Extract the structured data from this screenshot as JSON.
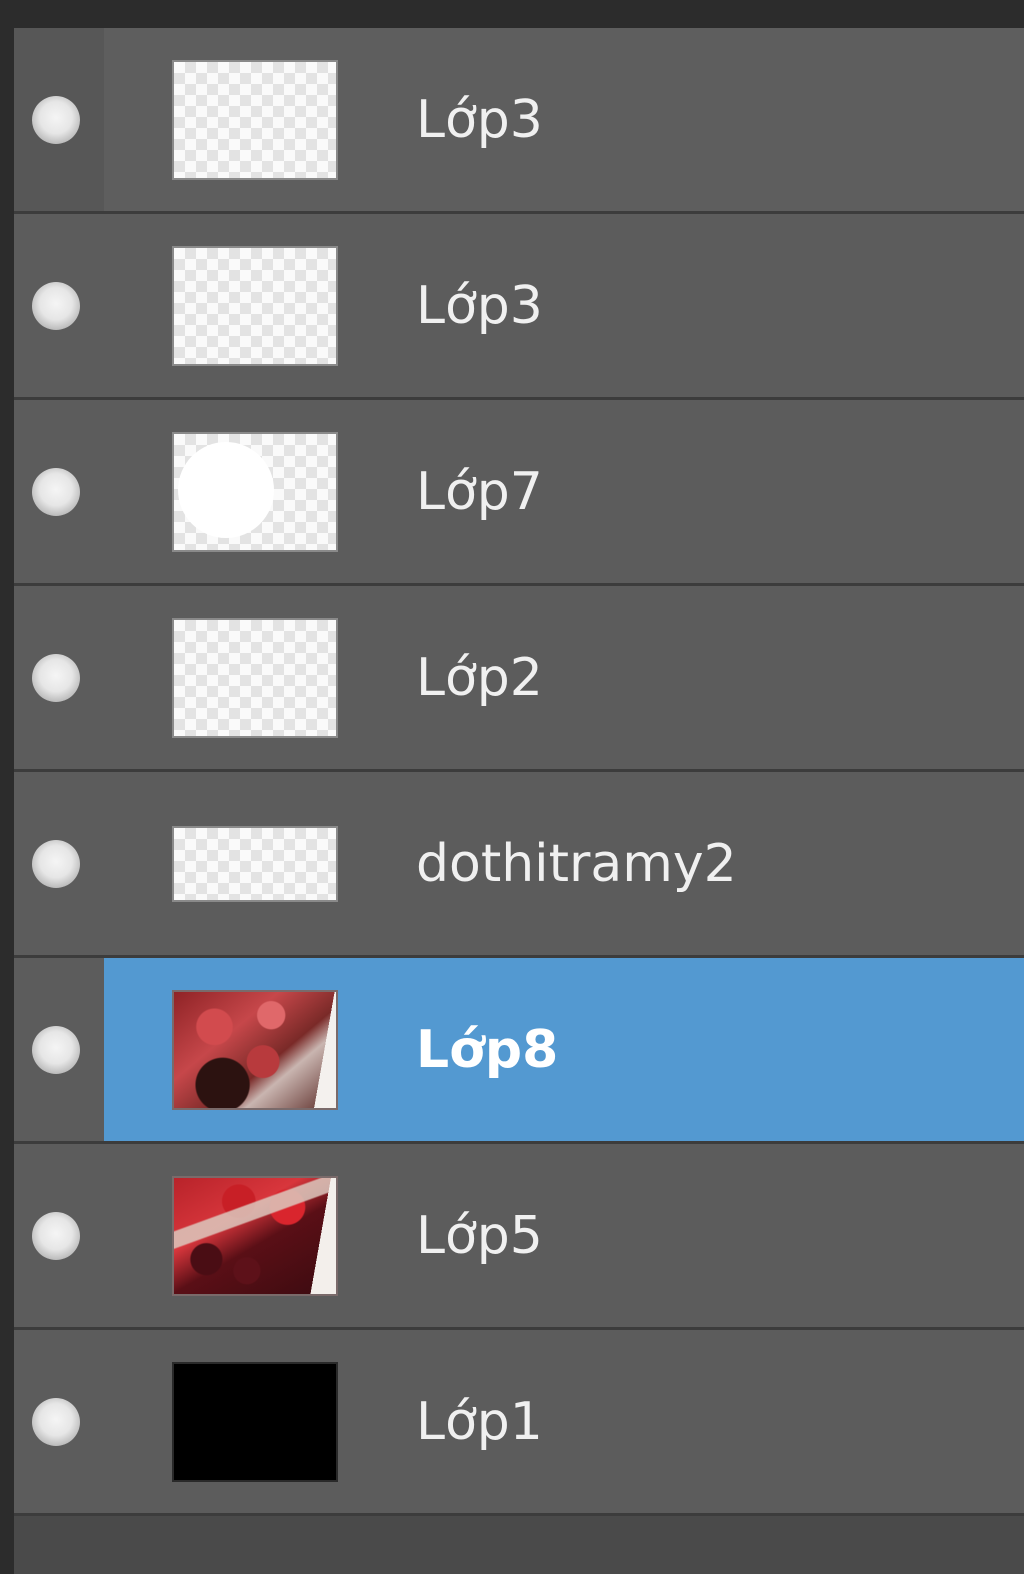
{
  "layers_panel": {
    "layers": [
      {
        "name": "Lớp3",
        "thumbnail": "transparent-empty",
        "selected": false,
        "visible": true
      },
      {
        "name": "Lớp3",
        "thumbnail": "transparent-empty",
        "selected": false,
        "visible": true
      },
      {
        "name": "Lớp7",
        "thumbnail": "white-shape",
        "selected": false,
        "visible": true
      },
      {
        "name": "Lớp2",
        "thumbnail": "transparent-empty",
        "selected": false,
        "visible": true
      },
      {
        "name": "dothitramy2",
        "thumbnail": "transparent-wide",
        "selected": false,
        "visible": true
      },
      {
        "name": "Lớp8",
        "thumbnail": "photo-strawberry-chocolate",
        "selected": true,
        "visible": true
      },
      {
        "name": "Lớp5",
        "thumbnail": "photo-strawberries-cherries",
        "selected": false,
        "visible": true
      },
      {
        "name": "Lớp1",
        "thumbnail": "black-fill",
        "selected": false,
        "visible": true
      }
    ],
    "colors": {
      "panel_bg": "#5c5c5c",
      "selected_bg": "#5399d1",
      "separator": "#3c3c3c",
      "text": "#f0f0f0"
    },
    "icons": {
      "visibility": "eye-visibility-icon"
    }
  }
}
